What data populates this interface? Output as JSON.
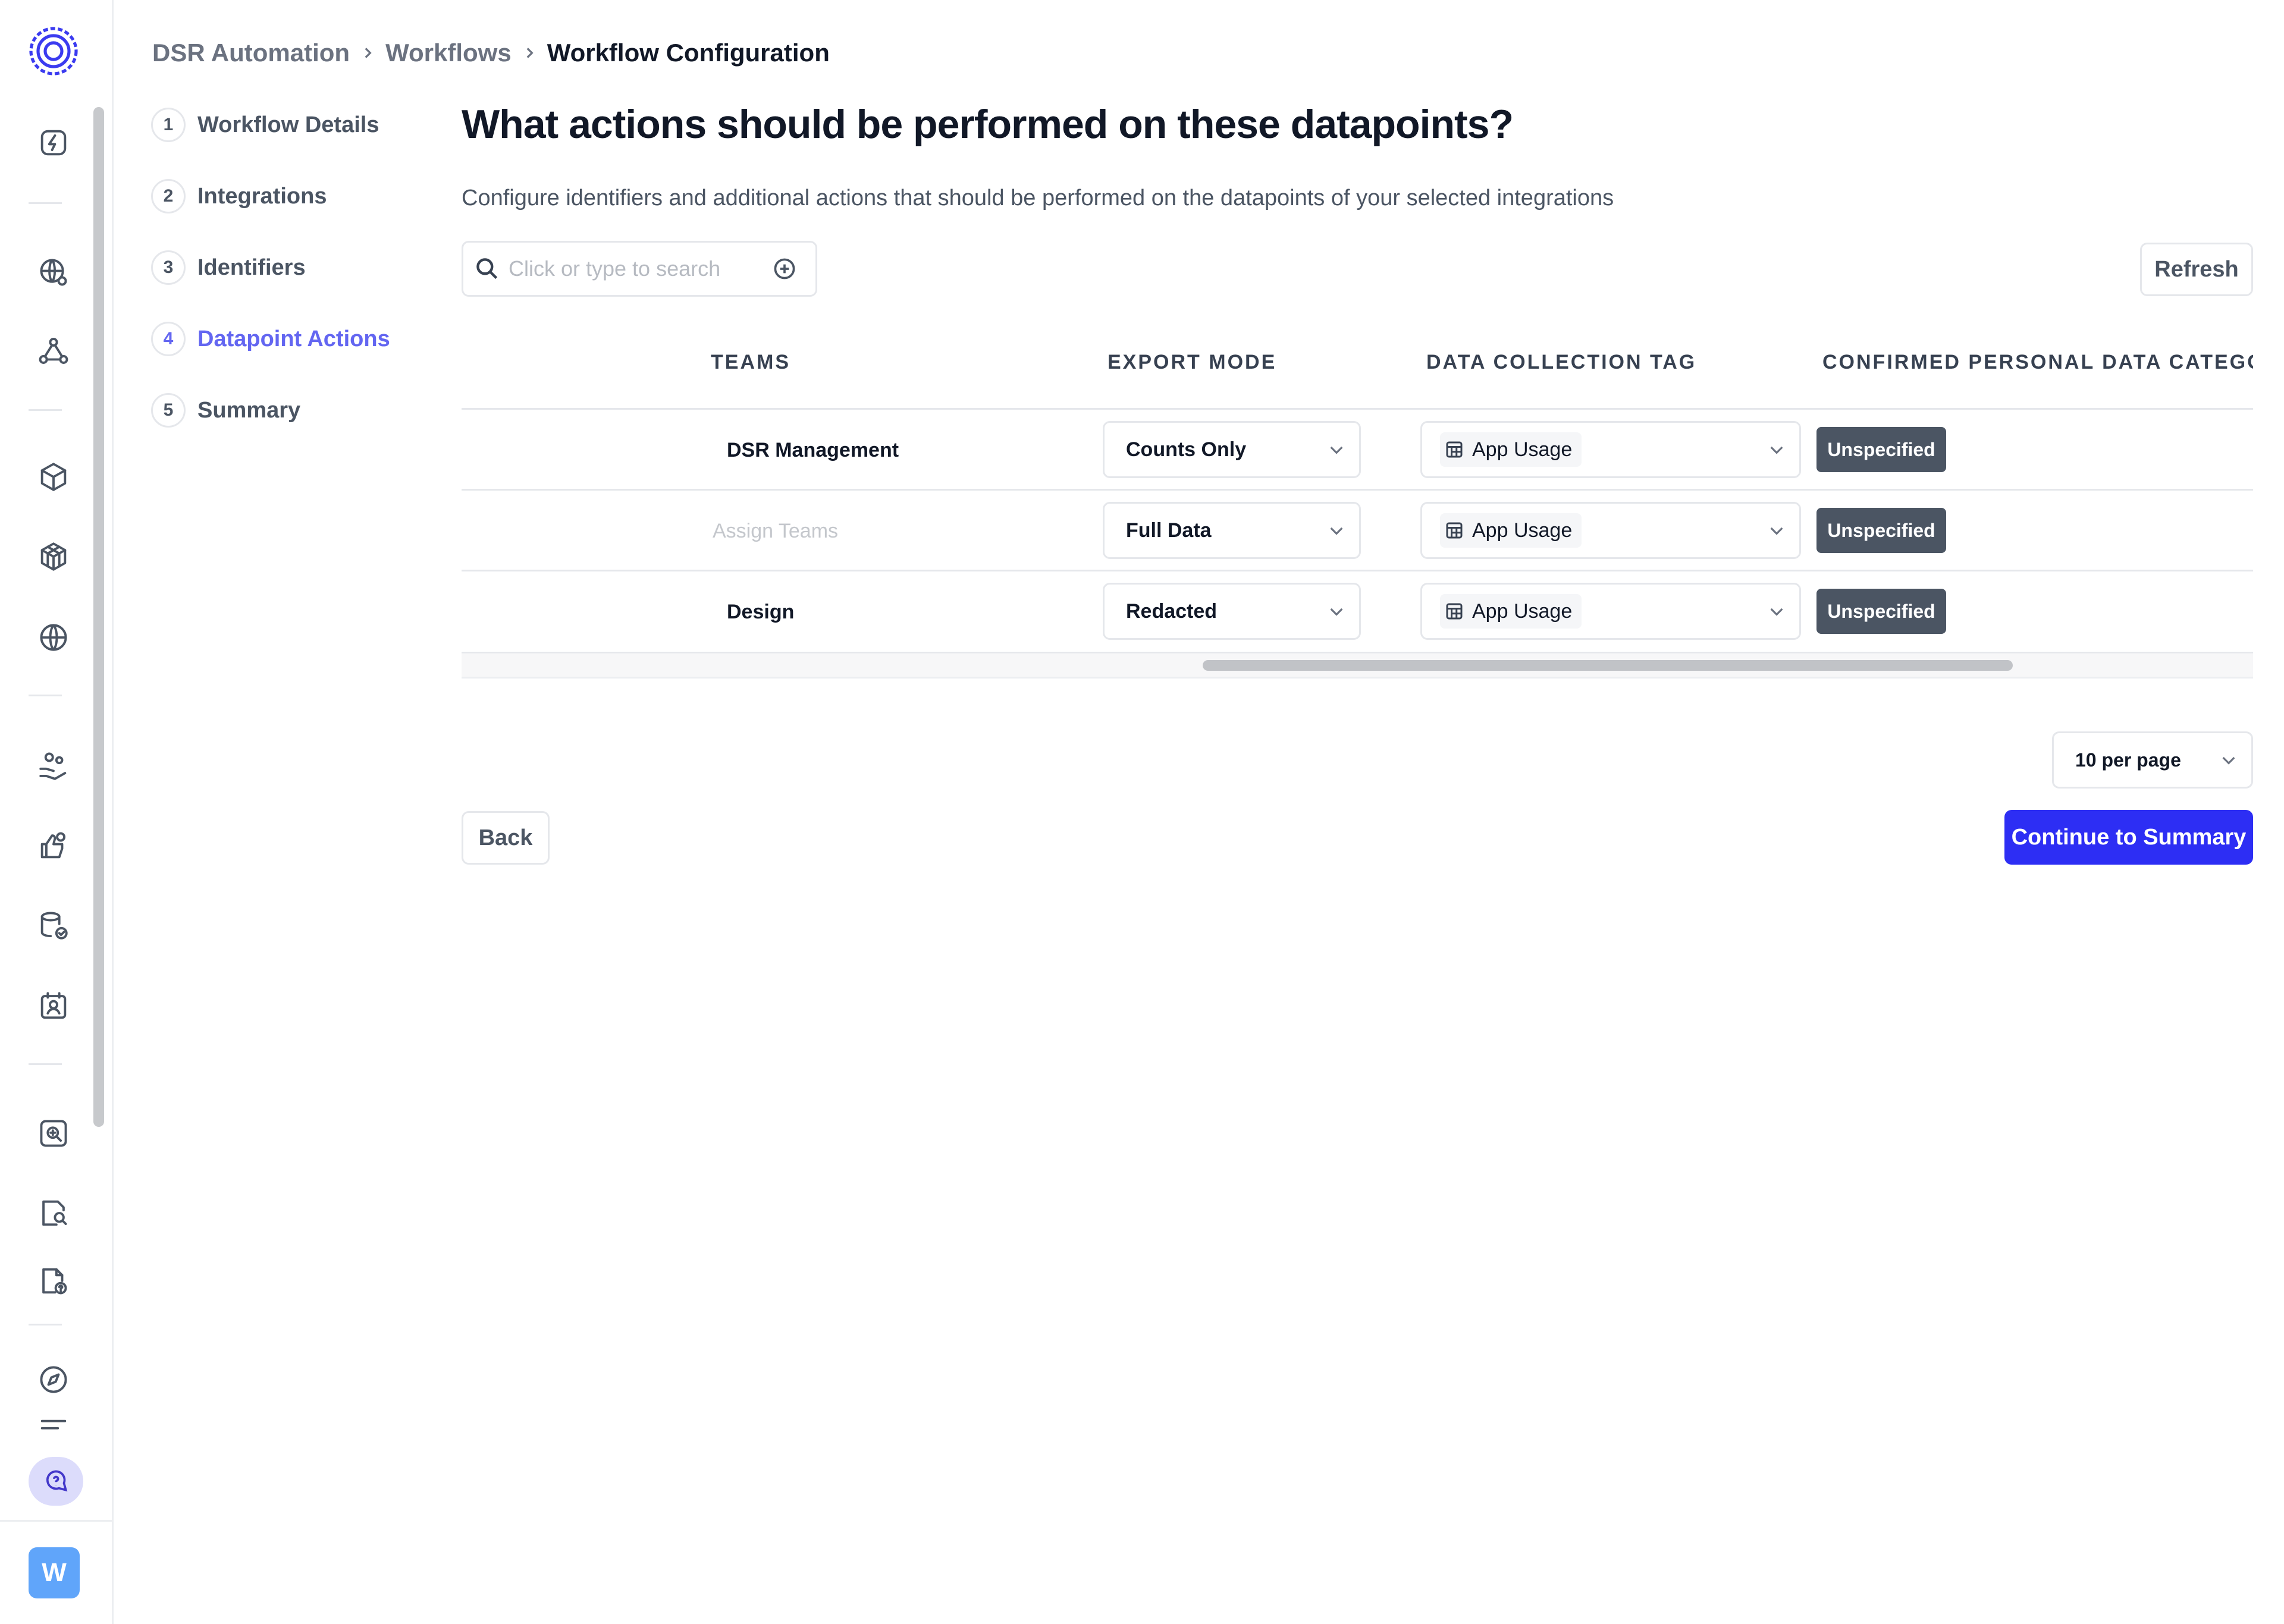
{
  "breadcrumb": {
    "items": [
      "DSR Automation",
      "Workflows",
      "Workflow Configuration"
    ]
  },
  "steps": [
    {
      "num": "1",
      "label": "Workflow Details"
    },
    {
      "num": "2",
      "label": "Integrations"
    },
    {
      "num": "3",
      "label": "Identifiers"
    },
    {
      "num": "4",
      "label": "Datapoint Actions",
      "active": true
    },
    {
      "num": "5",
      "label": "Summary"
    }
  ],
  "main": {
    "title": "What actions should be performed on these datapoints?",
    "description": "Configure identifiers and additional actions that should be performed on the datapoints of your selected integrations",
    "search_placeholder": "Click or type to search",
    "refresh_label": "Refresh"
  },
  "table": {
    "columns": [
      "TEAMS",
      "EXPORT MODE",
      "DATA COLLECTION TAG",
      "CONFIRMED PERSONAL DATA CATEGORIES"
    ],
    "rows": [
      {
        "team": "DSR Management",
        "export_mode": "Counts Only",
        "tag": "App Usage",
        "category": "Unspecified"
      },
      {
        "team": "Assign Teams",
        "team_is_placeholder": true,
        "export_mode": "Full Data",
        "tag": "App Usage",
        "category": "Unspecified"
      },
      {
        "team": "Design",
        "export_mode": "Redacted",
        "tag": "App Usage",
        "category": "Unspecified"
      }
    ]
  },
  "pagination": {
    "per_page": "10 per page"
  },
  "footer": {
    "back_label": "Back",
    "continue_label": "Continue to Summary"
  },
  "user": {
    "avatar_initial": "W"
  },
  "colors": {
    "accent": "#2d2ef4",
    "active_step": "#6366f1",
    "badge": "#4b5563"
  }
}
